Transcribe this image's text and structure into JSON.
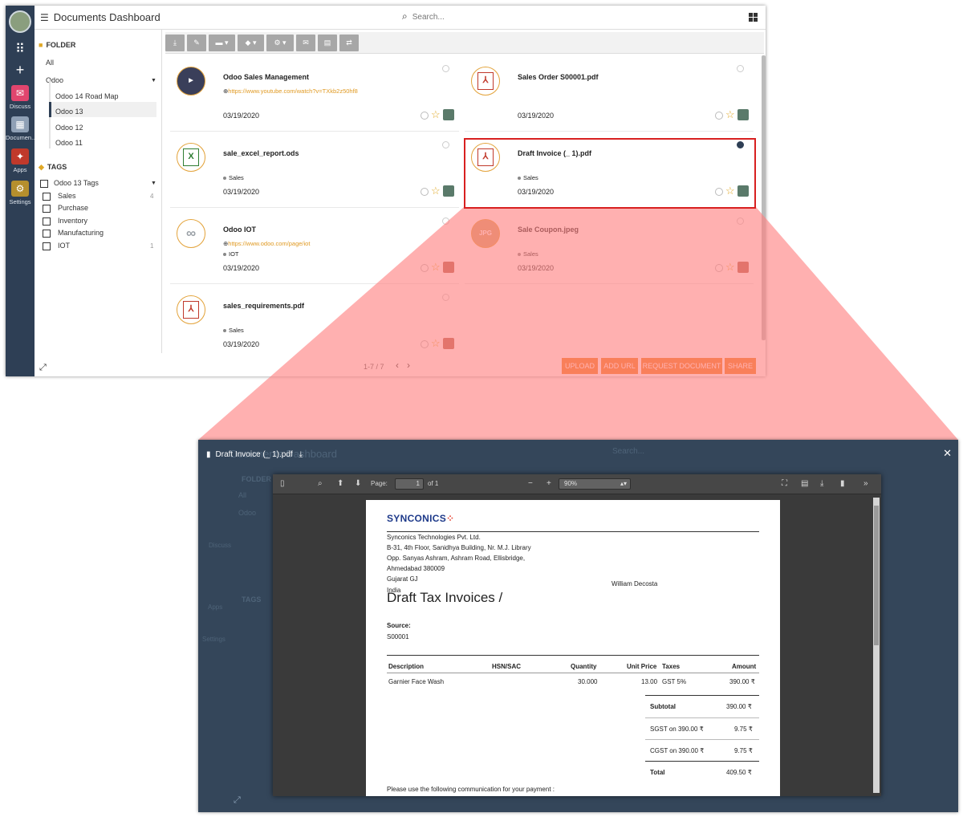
{
  "dashboard": {
    "title": "Documents Dashboard",
    "search_placeholder": "Search...",
    "rail": {
      "discuss": "Discuss",
      "documents": "Documen...",
      "apps": "Apps",
      "settings": "Settings"
    },
    "folder_heading": "FOLDER",
    "folders": {
      "all": "All",
      "root": "Odoo",
      "children": [
        "Odoo 14 Road Map",
        "Odoo 13",
        "Odoo 12",
        "Odoo 11"
      ]
    },
    "tags_heading": "TAGS",
    "tag_group": "Odoo 13 Tags",
    "tags": [
      {
        "label": "Sales",
        "count": "4"
      },
      {
        "label": "Purchase",
        "count": ""
      },
      {
        "label": "Inventory",
        "count": ""
      },
      {
        "label": "Manufacturing",
        "count": ""
      },
      {
        "label": "IOT",
        "count": "1"
      }
    ],
    "cards": [
      {
        "name": "Odoo Sales Management",
        "url": "https://www.youtube.com/watch?v=TXkb2z50hf8",
        "tag": "",
        "date": "03/19/2020",
        "thumb": "video"
      },
      {
        "name": "Sales Order S00001.pdf",
        "url": "",
        "tag": "",
        "date": "03/19/2020",
        "thumb": "pdf"
      },
      {
        "name": "sale_excel_report.ods",
        "url": "",
        "tag": "Sales",
        "date": "03/19/2020",
        "thumb": "xls"
      },
      {
        "name": "Draft Invoice (_ 1).pdf",
        "url": "",
        "tag": "Sales",
        "date": "03/19/2020",
        "thumb": "pdf"
      },
      {
        "name": "Odoo IOT",
        "url": "https://www.odoo.com/page/iot",
        "tag": "IOT",
        "date": "03/19/2020",
        "thumb": "link"
      },
      {
        "name": "Sale Coupon.jpeg",
        "url": "",
        "tag": "Sales",
        "date": "03/19/2020",
        "thumb": "image"
      },
      {
        "name": "sales_requirements.pdf",
        "url": "",
        "tag": "Sales",
        "date": "03/19/2020",
        "thumb": "pdf"
      }
    ],
    "thumb_labels": {
      "xls": "X",
      "image": "JPG"
    },
    "pager": "1-7 / 7",
    "buttons": [
      "UPLOAD",
      "ADD URL",
      "REQUEST DOCUMENT",
      "SHARE"
    ]
  },
  "preview": {
    "file_name": "Draft Invoice (_ 1).pdf",
    "toolbar": {
      "page_label": "Page:",
      "page_value": "1",
      "page_of": "of 1",
      "zoom": "90%"
    },
    "invoice": {
      "company_logo": "SYNCONICS",
      "address": [
        "Synconics Technologies Pvt. Ltd.",
        "B-31, 4th Floor, Sanidhya Building, Nr. M.J. Library",
        "Opp. Sanyas Ashram, Ashram Road, Ellisbridge,",
        "Ahmedabad 380009",
        "Gujarat GJ",
        "India"
      ],
      "customer": "William Decosta",
      "title": "Draft Tax Invoices /",
      "source_label": "Source:",
      "source": "S00001",
      "headers": [
        "Description",
        "HSN/SAC",
        "Quantity",
        "Unit Price",
        "Taxes",
        "Amount"
      ],
      "line": {
        "description": "Garnier Face Wash",
        "quantity": "30.000",
        "unit_price": "13.00",
        "taxes": "GST 5%",
        "amount": "390.00 ₹"
      },
      "subtotal_label": "Subtotal",
      "subtotal": "390.00 ₹",
      "sgst_label": "SGST  on 390.00 ₹",
      "sgst": "9.75 ₹",
      "cgst_label": "CGST  on 390.00 ₹",
      "cgst": "9.75 ₹",
      "total_label": "Total",
      "total": "409.50 ₹",
      "footer": "Please use the following communication for your payment :"
    }
  },
  "colors": {
    "rail": "#2e3f55",
    "accent": "#ee7f1f",
    "highlight": "#d82020",
    "overlay": "#ff8080"
  }
}
